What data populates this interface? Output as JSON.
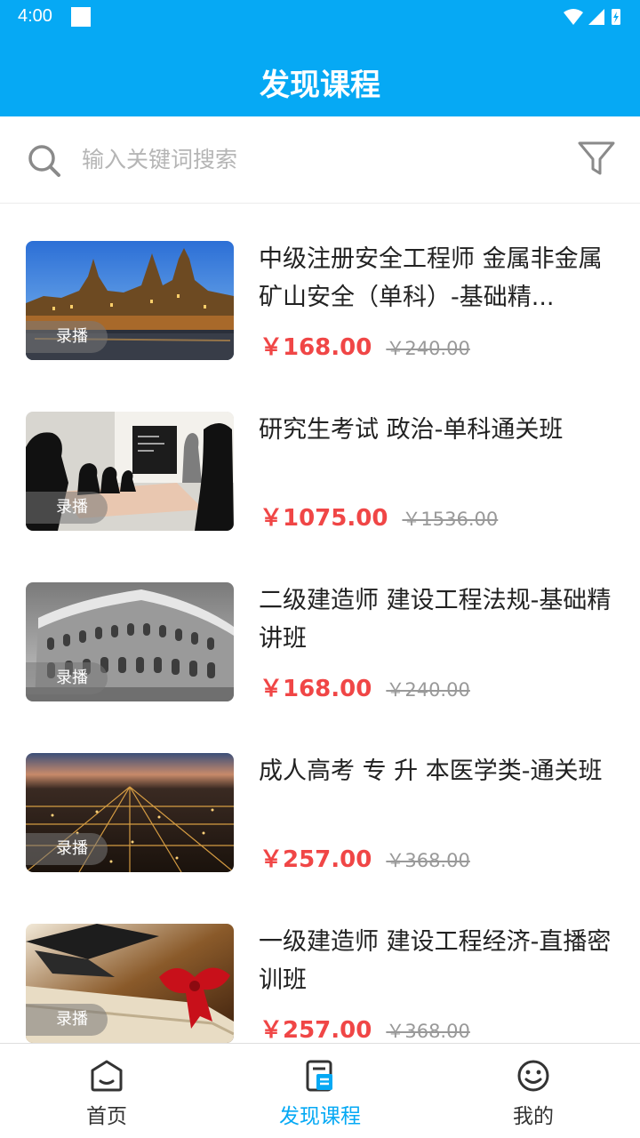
{
  "status_bar": {
    "time": "4:00"
  },
  "header": {
    "title": "发现课程"
  },
  "search": {
    "placeholder": "输入关键词搜索",
    "icon": "search-icon",
    "filter_icon": "filter-icon"
  },
  "courses": [
    {
      "title": "中级注册安全工程师 金属非金属矿山安全（单科）-基础精...",
      "price": "￥168.00",
      "original_price": "￥240.00",
      "badge": "录播",
      "image": "city-cathedral-dusk"
    },
    {
      "title": "研究生考试 政治-单科通关班",
      "price": "￥1075.00",
      "original_price": "￥1536.00",
      "badge": "录播",
      "image": "classroom-silhouettes"
    },
    {
      "title": "二级建造师 建设工程法规-基础精讲班",
      "price": "￥168.00",
      "original_price": "￥240.00",
      "badge": "录播",
      "image": "colosseum"
    },
    {
      "title": "成人高考 专 升 本医学类-通关班",
      "price": "￥257.00",
      "original_price": "￥368.00",
      "badge": "录播",
      "image": "city-lights-night"
    },
    {
      "title": "一级建造师 建设工程经济-直播密训班",
      "price": "￥257.00",
      "original_price": "￥368.00",
      "badge": "录播",
      "image": "graduation-diploma"
    }
  ],
  "bottom_nav": [
    {
      "label": "首页",
      "icon": "home-icon",
      "active": false
    },
    {
      "label": "发现课程",
      "icon": "courses-icon",
      "active": true
    },
    {
      "label": "我的",
      "icon": "smiley-icon",
      "active": false
    }
  ],
  "colors": {
    "primary": "#06a9f4",
    "price": "#f04646",
    "muted": "#999999"
  }
}
